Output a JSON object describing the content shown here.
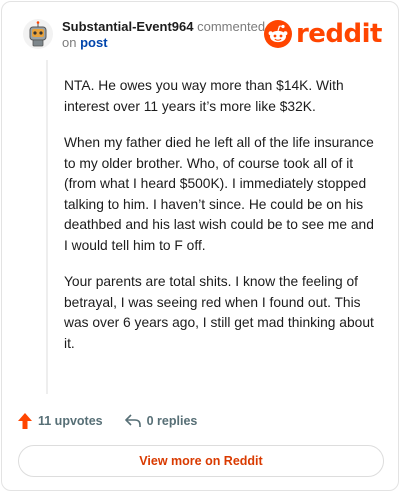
{
  "header": {
    "username": "Substantial-Event964",
    "action_text": "commented",
    "on_text": "on",
    "post_link": "post",
    "logo_text": "reddit",
    "avatar_icon": "robot-avatar-icon",
    "logo_icon": "reddit-snoo-icon"
  },
  "comment": {
    "paragraphs": [
      "NTA. He owes you way more than $14K. With interest over 11 years it’s more like $32K.",
      "When my father died he left all of the life insurance to my older brother. Who, of course took all of it (from what I heard $500K). I immediately stopped talking to him. I haven’t since. He could be on his deathbed and his last wish could be to see me and I would tell him to F off.",
      "Your parents are total shits. I know the feeling of betrayal, I was seeing red when I found out. This was over 6 years ago, I still get mad thinking about it."
    ]
  },
  "actions": {
    "upvotes": "11 upvotes",
    "replies": "0 replies",
    "upvote_icon": "upvote-arrow-icon",
    "reply_icon": "reply-arrow-icon"
  },
  "footer": {
    "view_more": "View more on Reddit"
  },
  "colors": {
    "brand": "#ff4500",
    "link": "#0045ac",
    "view_more": "#d93a00",
    "muted": "#576f76"
  }
}
